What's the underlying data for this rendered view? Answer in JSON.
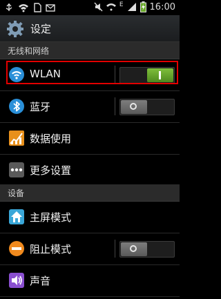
{
  "status_bar": {
    "time": "16:00",
    "network_letter": "E",
    "left_icons": [
      "usb-icon",
      "wifi-icon",
      "sd-card-icon",
      "notification-icon"
    ],
    "right_icons": [
      "mute-icon",
      "wifi-icon",
      "signal-icon",
      "battery-charging-icon"
    ]
  },
  "action_bar": {
    "title": "设定",
    "icon": "gear-icon"
  },
  "sections": [
    {
      "header": "无线和网络",
      "items": [
        {
          "label": "WLAN",
          "icon": "wifi-icon",
          "toggle": "on",
          "highlighted": true
        },
        {
          "label": "蓝牙",
          "icon": "bluetooth-icon",
          "toggle": "off"
        },
        {
          "label": "数据使用",
          "icon": "data-usage-icon"
        },
        {
          "label": "更多设置",
          "icon": "more-icon"
        }
      ]
    },
    {
      "header": "设备",
      "items": [
        {
          "label": "主屏模式",
          "icon": "home-icon"
        },
        {
          "label": "阻止模式",
          "icon": "block-icon",
          "toggle": "off"
        },
        {
          "label": "声音",
          "icon": "sound-icon"
        }
      ]
    }
  ],
  "colors": {
    "highlight_border": "#e30000",
    "toggle_on": "#6aa82c",
    "wifi_icon": "#2a8fd8"
  }
}
